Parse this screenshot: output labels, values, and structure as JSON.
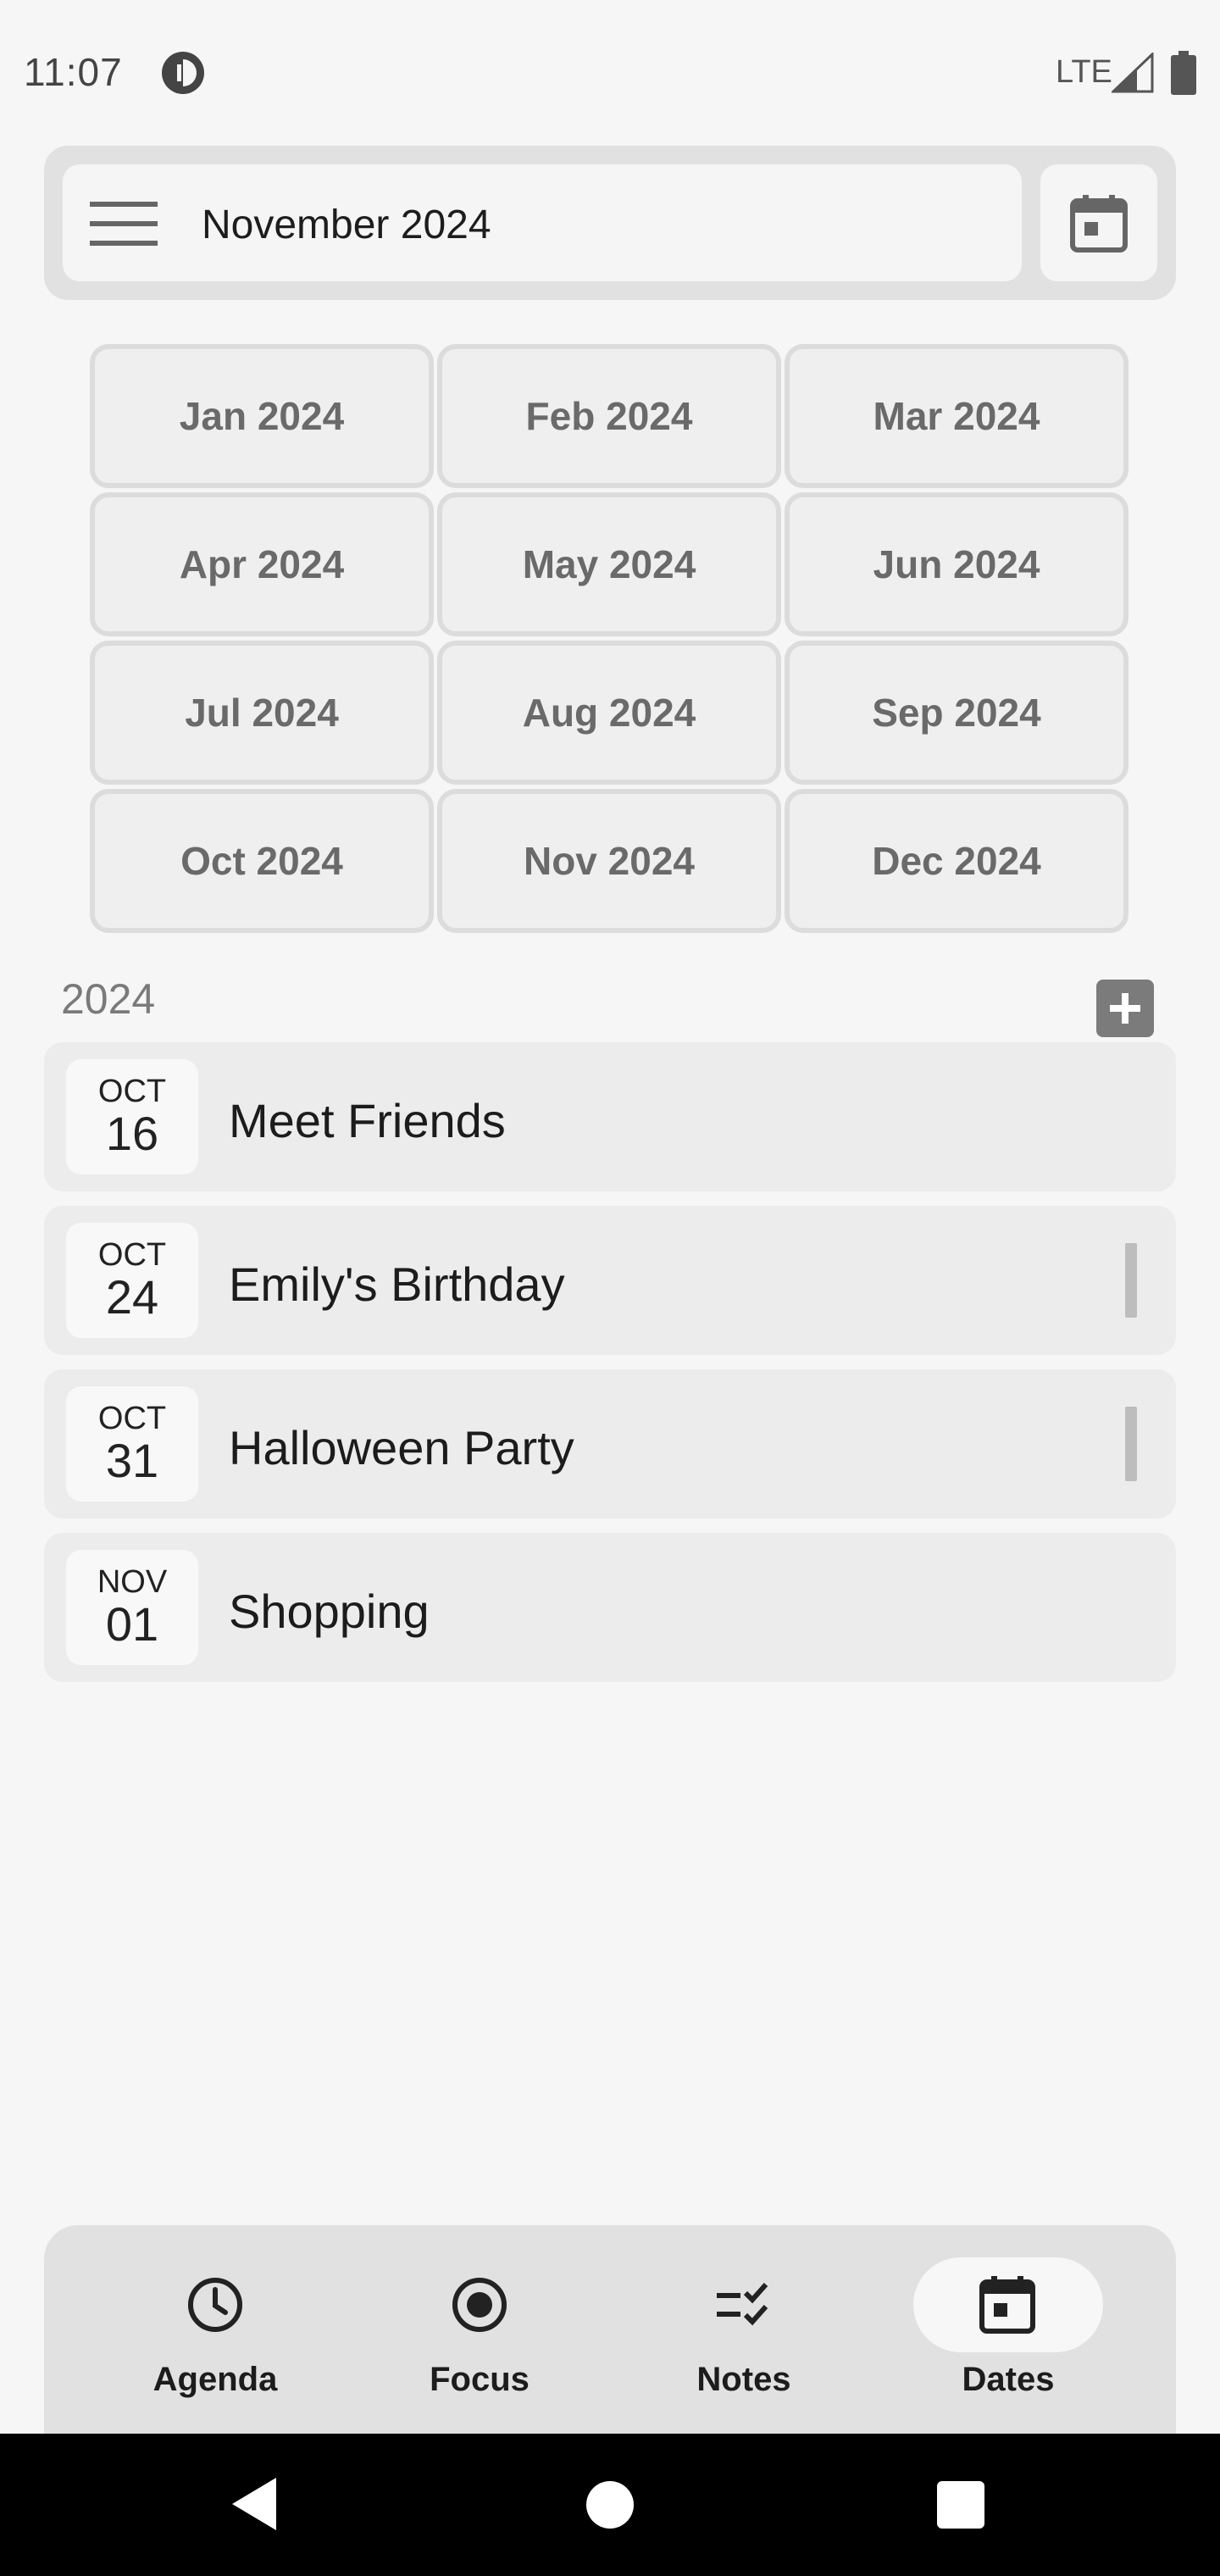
{
  "status_bar": {
    "time": "11:07",
    "network": "LTE"
  },
  "header": {
    "title": "November 2024",
    "menu_icon": "hamburger-menu-icon",
    "calendar_icon": "calendar-icon"
  },
  "months": [
    "Jan 2024",
    "Feb 2024",
    "Mar 2024",
    "Apr 2024",
    "May 2024",
    "Jun 2024",
    "Jul 2024",
    "Aug 2024",
    "Sep 2024",
    "Oct 2024",
    "Nov 2024",
    "Dec 2024"
  ],
  "year_section": {
    "year": "2024",
    "add_icon": "plus-icon"
  },
  "events": [
    {
      "month": "OCT",
      "day": "16",
      "title": "Meet Friends",
      "has_handle": false
    },
    {
      "month": "OCT",
      "day": "24",
      "title": "Emily's Birthday",
      "has_handle": true
    },
    {
      "month": "OCT",
      "day": "31",
      "title": "Halloween Party",
      "has_handle": true
    },
    {
      "month": "NOV",
      "day": "01",
      "title": "Shopping",
      "has_handle": false
    }
  ],
  "bottom_nav": [
    {
      "label": "Agenda",
      "icon": "clock-icon",
      "active": false
    },
    {
      "label": "Focus",
      "icon": "focus-target-icon",
      "active": false
    },
    {
      "label": "Notes",
      "icon": "checklist-icon",
      "active": false
    },
    {
      "label": "Dates",
      "icon": "calendar-icon",
      "active": true
    }
  ],
  "colors": {
    "background": "#f6f6f6",
    "surface": "#e1e1e1",
    "card": "#ececec",
    "text": "#1c1c1c",
    "muted_text": "#6a6a6a"
  }
}
